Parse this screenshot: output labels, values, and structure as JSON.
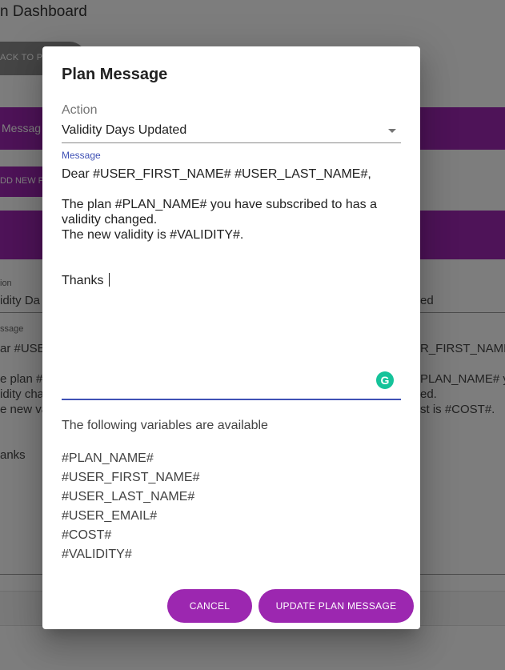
{
  "background": {
    "title": "n Dashboard",
    "back_button": "ACK TO P",
    "bar_label": "Messag",
    "add_button": "DD NEW P",
    "field_label_action": "ion",
    "field_value_action": "idity Da",
    "field_value_right": "ed",
    "field_label_message": "ssage",
    "left_lines": [
      "ar #USE",
      "e plan #",
      "idity cha",
      "e new va",
      "anks"
    ],
    "right_lines": [
      "R_FIRST_NAME",
      "PLAN_NAME# y",
      "ed.",
      "st is #COST#."
    ]
  },
  "dialog": {
    "title": "Plan Message",
    "action_label": "Action",
    "action_value": "Validity Days Updated",
    "message_label": "Message",
    "message_lines": [
      "Dear #USER_FIRST_NAME# #USER_LAST_NAME#,",
      "",
      "The plan #PLAN_NAME# you have subscribed to has a",
      "validity changed.",
      "The new validity is #VALIDITY#.",
      "",
      "",
      "Thanks "
    ],
    "grammarly_icon": "G",
    "variables_heading": "The following variables are available",
    "variables": [
      "#PLAN_NAME#",
      "#USER_FIRST_NAME#",
      "#USER_LAST_NAME#",
      "#USER_EMAIL#",
      "#COST#",
      "#VALIDITY#"
    ],
    "cancel_label": "CANCEL",
    "update_label": "UPDATE PLAN MESSAGE"
  },
  "colors": {
    "accent": "#9c27b0",
    "focus": "#3f51b5",
    "grammarly": "#15c39a"
  }
}
